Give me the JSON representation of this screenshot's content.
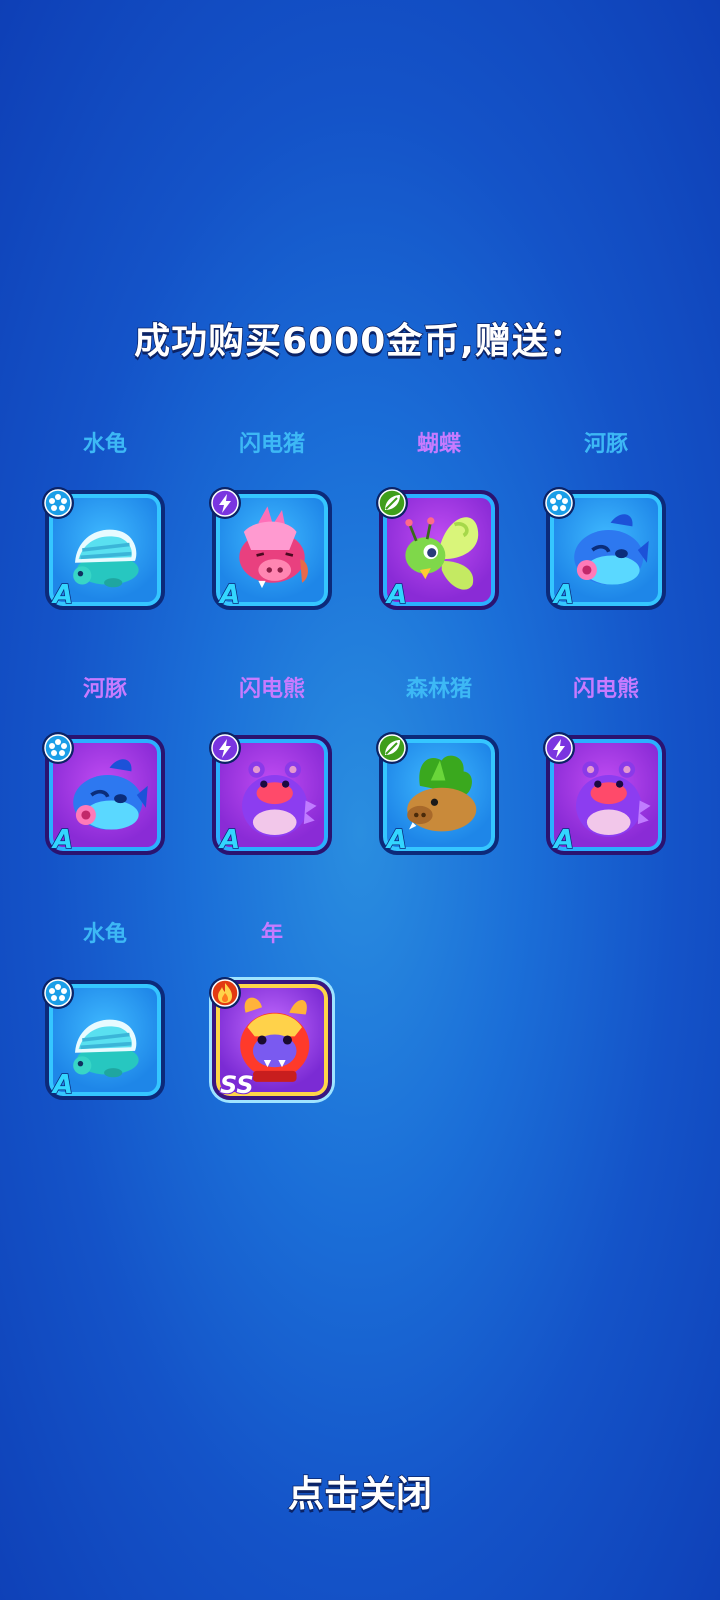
{
  "title": "成功购买6000金币,赠送：",
  "close_label": "点击关闭",
  "colors": {
    "name_blue": "#3db8f5",
    "name_purple": "#c77bff",
    "water": "#35c6ff",
    "electric": "#9b4dff",
    "grass": "#7ed321",
    "fire": "#ff5a1f"
  },
  "rewards": [
    {
      "name": "水龟",
      "element": "water",
      "rank": "A",
      "card": "blue",
      "art": "turtle"
    },
    {
      "name": "闪电猪",
      "element": "electric",
      "rank": "A",
      "card": "blue",
      "art": "pig"
    },
    {
      "name": "蝴蝶",
      "element": "grass",
      "rank": "A",
      "card": "purple",
      "art": "butterfly"
    },
    {
      "name": "河豚",
      "element": "water",
      "rank": "A",
      "card": "blue",
      "art": "puffer"
    },
    {
      "name": "河豚",
      "element": "water",
      "rank": "A",
      "card": "purple",
      "art": "puffer"
    },
    {
      "name": "闪电熊",
      "element": "electric",
      "rank": "A",
      "card": "purple",
      "art": "bear"
    },
    {
      "name": "森林猪",
      "element": "grass",
      "rank": "A",
      "card": "blue",
      "art": "forestpig"
    },
    {
      "name": "闪电熊",
      "element": "electric",
      "rank": "A",
      "card": "purple",
      "art": "bear"
    },
    {
      "name": "水龟",
      "element": "water",
      "rank": "A",
      "card": "blue",
      "art": "turtle"
    },
    {
      "name": "年",
      "element": "fire",
      "rank": "SS",
      "card": "gold",
      "art": "nian"
    }
  ]
}
